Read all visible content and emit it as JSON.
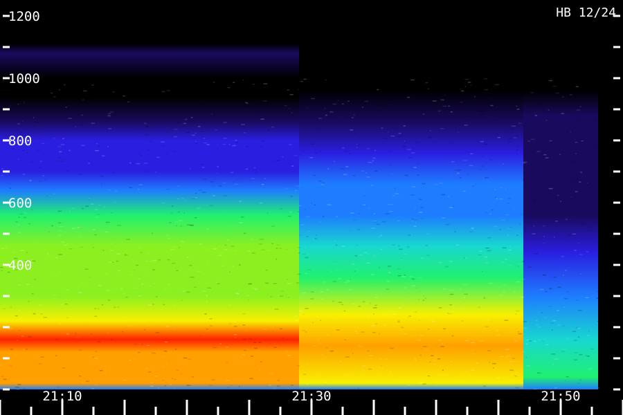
{
  "chart_data": {
    "type": "heatmap",
    "title": "",
    "corner_label": "HB 12/24",
    "xlabel": "",
    "ylabel": "",
    "x_range": [
      "21:05",
      "21:55"
    ],
    "y_range": [
      0,
      1270
    ],
    "x_tick_labels": [
      "21:10",
      "21:30",
      "21:50"
    ],
    "y_tick_labels": [
      "1200",
      "1000",
      "800",
      "600",
      "400"
    ],
    "signal_end_time": "21:53",
    "palette": [
      "#000000",
      "#1a0a5e",
      "#2a1ee0",
      "#1e7cff",
      "#18d7d0",
      "#20f070",
      "#8cf020",
      "#f8f000",
      "#ffa000",
      "#ff2000"
    ],
    "bands": [
      {
        "start": "21:05",
        "end": "21:29",
        "levels": [
          {
            "y": 0,
            "level": 3
          },
          {
            "y": 20,
            "level": 8
          },
          {
            "y": 120,
            "level": 7.5
          },
          {
            "y": 160,
            "level": 8.5
          },
          {
            "y": 220,
            "level": 7
          },
          {
            "y": 300,
            "level": 6
          },
          {
            "y": 380,
            "level": 6.2
          },
          {
            "y": 460,
            "level": 5.5
          },
          {
            "y": 560,
            "level": 5
          },
          {
            "y": 640,
            "level": 3
          },
          {
            "y": 700,
            "level": 2
          },
          {
            "y": 760,
            "level": 1.6
          },
          {
            "y": 800,
            "level": 2.2
          },
          {
            "y": 860,
            "level": 1.2
          },
          {
            "y": 940,
            "level": 0.4
          },
          {
            "y": 1000,
            "level": 0.1
          },
          {
            "y": 1080,
            "level": 0.6
          },
          {
            "y": 1110,
            "level": 0
          }
        ]
      },
      {
        "start": "21:29",
        "end": "21:47",
        "levels": [
          {
            "y": 0,
            "level": 3
          },
          {
            "y": 20,
            "level": 7
          },
          {
            "y": 140,
            "level": 7.8
          },
          {
            "y": 240,
            "level": 6.6
          },
          {
            "y": 360,
            "level": 5.4
          },
          {
            "y": 460,
            "level": 4
          },
          {
            "y": 560,
            "level": 3.4
          },
          {
            "y": 660,
            "level": 2.6
          },
          {
            "y": 760,
            "level": 1.6
          },
          {
            "y": 860,
            "level": 1
          },
          {
            "y": 960,
            "level": 0.3
          },
          {
            "y": 1000,
            "level": 0
          }
        ]
      },
      {
        "start": "21:47",
        "end": "21:53",
        "levels": [
          {
            "y": 0,
            "level": 3
          },
          {
            "y": 40,
            "level": 5
          },
          {
            "y": 160,
            "level": 4.4
          },
          {
            "y": 300,
            "level": 3
          },
          {
            "y": 440,
            "level": 1.8
          },
          {
            "y": 560,
            "level": 1.2
          },
          {
            "y": 760,
            "level": 0.6
          },
          {
            "y": 880,
            "level": 0.8
          },
          {
            "y": 960,
            "level": 0
          }
        ]
      }
    ]
  }
}
